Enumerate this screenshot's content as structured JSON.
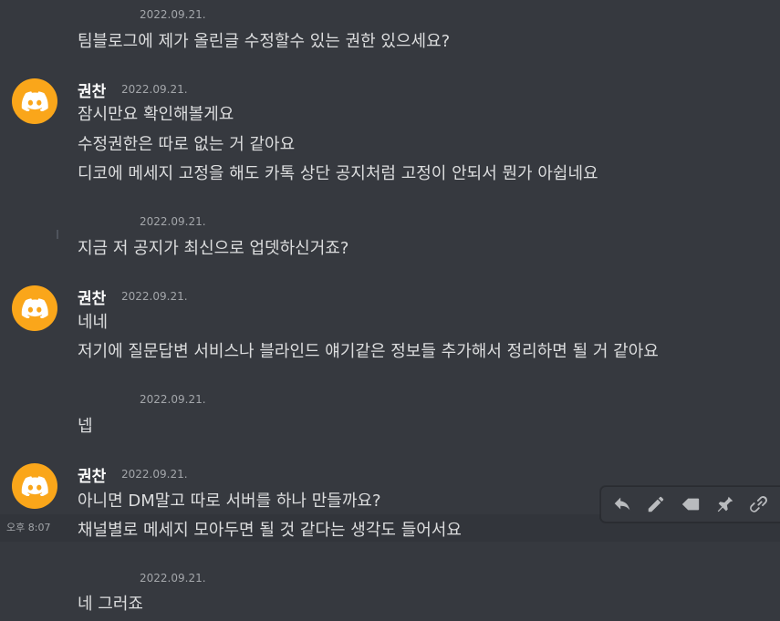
{
  "messages": {
    "m1": {
      "timestamp": "2022.09.21.",
      "lines": [
        "팀블로그에 제가 올린글 수정할수 있는 권한 있으세요?"
      ]
    },
    "m2": {
      "author": "권찬",
      "timestamp": "2022.09.21.",
      "lines": [
        "잠시만요 확인해볼게요",
        "수정권한은 따로 없는 거 같아요",
        "디코에 메세지 고정을 해도 카톡 상단 공지처럼 고정이 안되서 뭔가 아쉽네요"
      ]
    },
    "m3": {
      "timestamp": "2022.09.21.",
      "lines": [
        "지금 저 공지가 최신으로 업뎃하신거죠?"
      ]
    },
    "m4": {
      "author": "권찬",
      "timestamp": "2022.09.21.",
      "lines": [
        "네네",
        "저기에 질문답변 서비스나 블라인드 얘기같은 정보들 추가해서 정리하면 될 거 같아요"
      ]
    },
    "m5": {
      "timestamp": "2022.09.21.",
      "lines": [
        "넵"
      ]
    },
    "m6": {
      "author": "권찬",
      "timestamp": "2022.09.21.",
      "lines": [
        "아니면 DM말고 따로 서버를 하나 만들까요?",
        "채널별로 메세지 모아두면 될 것 같다는 생각도 들어서요"
      ],
      "hover_time": "오후 8:07"
    },
    "m7": {
      "timestamp": "2022.09.21.",
      "lines": [
        "네 그러죠"
      ]
    }
  },
  "toolbar_icons": [
    "reply-icon",
    "edit-icon",
    "tag-icon",
    "pin-icon",
    "link-icon"
  ],
  "colors": {
    "background": "#36393f",
    "avatar": "#faa61a",
    "text": "#dcddde",
    "muted": "#a3a6aa"
  }
}
